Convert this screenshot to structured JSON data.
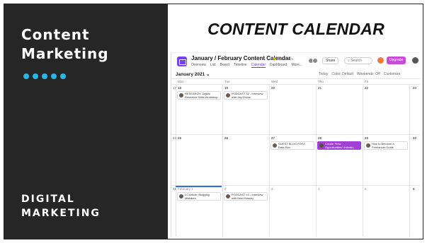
{
  "slide": {
    "title_line1": "Content",
    "title_line2": "Marketing",
    "subtitle_line1": "DIGITAL",
    "subtitle_line2": "MARKETING",
    "heading": "CONTENT CALENDAR",
    "accent_color": "#2ab7e6",
    "dot_count": 5
  },
  "app": {
    "project_title": "January / February Content Calendar",
    "set_status": "Set status",
    "tabs": [
      "Overview",
      "List",
      "Board",
      "Timeline",
      "Calendar",
      "Dashboard",
      "More..."
    ],
    "active_tab": "Calendar",
    "share_label": "Share",
    "search_placeholder": "Search",
    "upgrade_label": "Upgrade",
    "brand_color": "#7b3ff2",
    "month_label": "January 2021",
    "month_tools": [
      "Today",
      "Color: Default",
      "Weekends: Off",
      "Customize"
    ],
    "weekdays": [
      "Mon",
      "Tue",
      "Wed",
      "Thu",
      "Fri"
    ],
    "weeks": [
      {
        "week_num": "17",
        "days": [
          "18",
          "19",
          "20",
          "21",
          "22"
        ],
        "extra": "23",
        "events": [
          {
            "day": 0,
            "label": "RESEARCH: Digital Research Skills Workshop",
            "style": "normal"
          },
          {
            "day": 1,
            "label": "PODCAST 32 - Interview with Jay Chiron",
            "style": "normal"
          }
        ]
      },
      {
        "week_num": "24",
        "days": [
          "25",
          "26",
          "27",
          "28",
          "29"
        ],
        "extra": "30",
        "events": [
          {
            "day": 2,
            "label": "GUEST BLOG POST: Data Star",
            "style": "normal"
          },
          {
            "day": 3,
            "label": "Create \"New Opportunities\" Industry Guide",
            "style": "purple"
          },
          {
            "day": 4,
            "label": "How to Become a Freelancer Guide",
            "style": "normal"
          }
        ]
      },
      {
        "week_num": "31",
        "days": [
          "February 1",
          "2",
          "3",
          "4",
          "5"
        ],
        "extra": "6",
        "events": [
          {
            "day": 0,
            "label": "LC Article: Blogging Mistakes",
            "style": "normal"
          },
          {
            "day": 1,
            "label": "PODCAST 43 - Interview with Brad Hussey",
            "style": "normal"
          }
        ]
      }
    ]
  }
}
